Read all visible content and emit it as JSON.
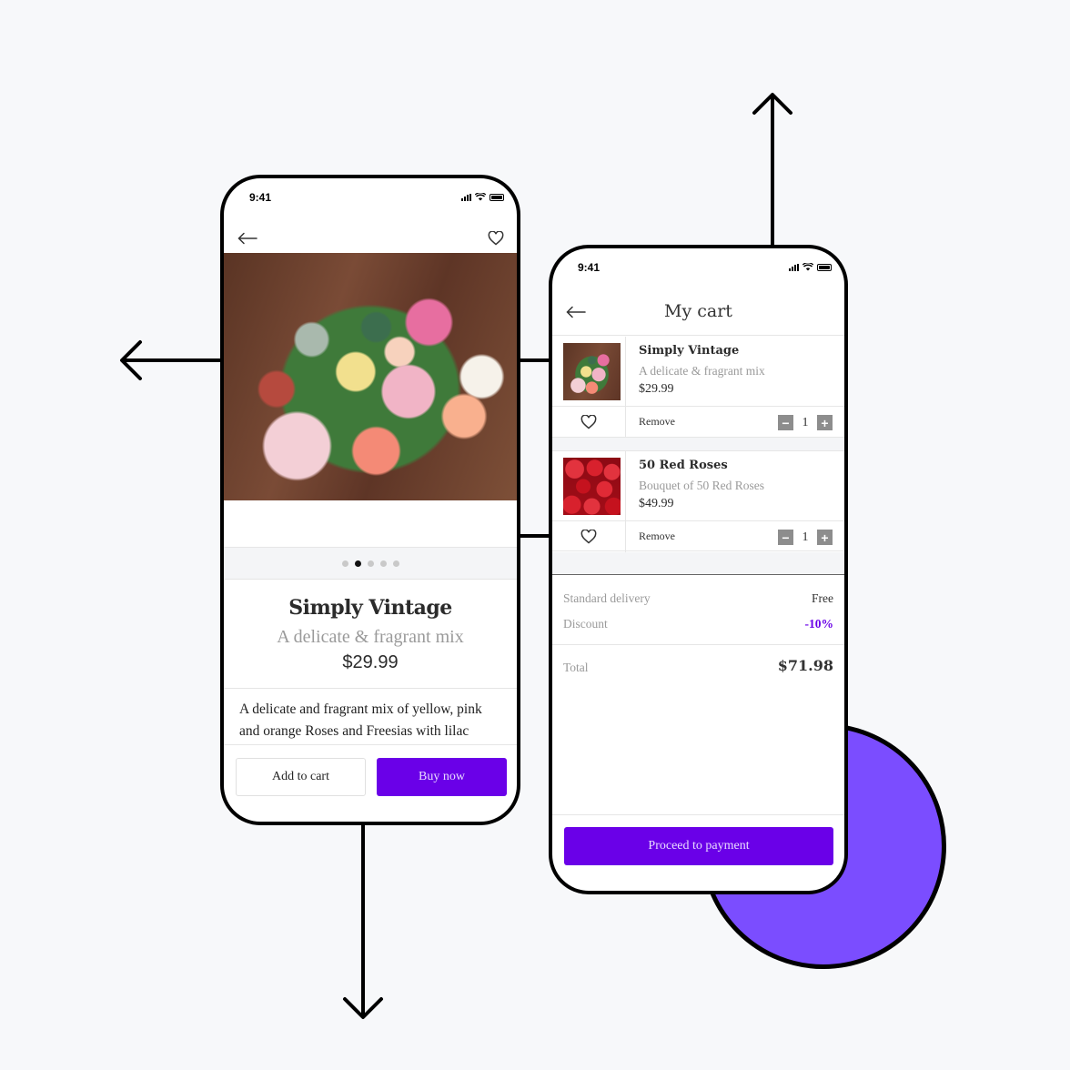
{
  "colors": {
    "accent": "#6a00e8",
    "circle": "#7b4dff",
    "background": "#f7f8fa"
  },
  "product_screen": {
    "status_time": "9:41",
    "back_icon": "arrow-left-icon",
    "favorite_icon": "heart-icon",
    "image_alt": "Bouquet of roses, freesias and succulents",
    "carousel": {
      "count": 5,
      "active_index": 1
    },
    "title": "Simply Vintage",
    "subtitle": "A delicate & fragrant mix",
    "price": "$29.99",
    "description": "A delicate and fragrant mix of yellow, pink and orange Roses and Freesias with lilac",
    "add_to_cart_label": "Add to cart",
    "buy_now_label": "Buy now"
  },
  "cart_screen": {
    "status_time": "9:41",
    "title": "My cart",
    "items": [
      {
        "name": "Simply Vintage",
        "description": "A delicate & fragrant mix",
        "price": "$29.99",
        "remove_label": "Remove",
        "quantity": "1",
        "image": "bouquet-photo"
      },
      {
        "name": "50 Red Roses",
        "description": "Bouquet of 50 Red Roses",
        "price": "$49.99",
        "remove_label": "Remove",
        "quantity": "1",
        "image": "red-roses-photo"
      }
    ],
    "summary": {
      "delivery_label": "Standard delivery",
      "delivery_value": "Free",
      "discount_label": "Discount",
      "discount_value": "-10%",
      "total_label": "Total",
      "total_value": "$71.98"
    },
    "proceed_label": "Proceed to payment"
  },
  "decor": {
    "arrows": [
      "arrow-left",
      "arrow-up",
      "arrow-down"
    ]
  }
}
